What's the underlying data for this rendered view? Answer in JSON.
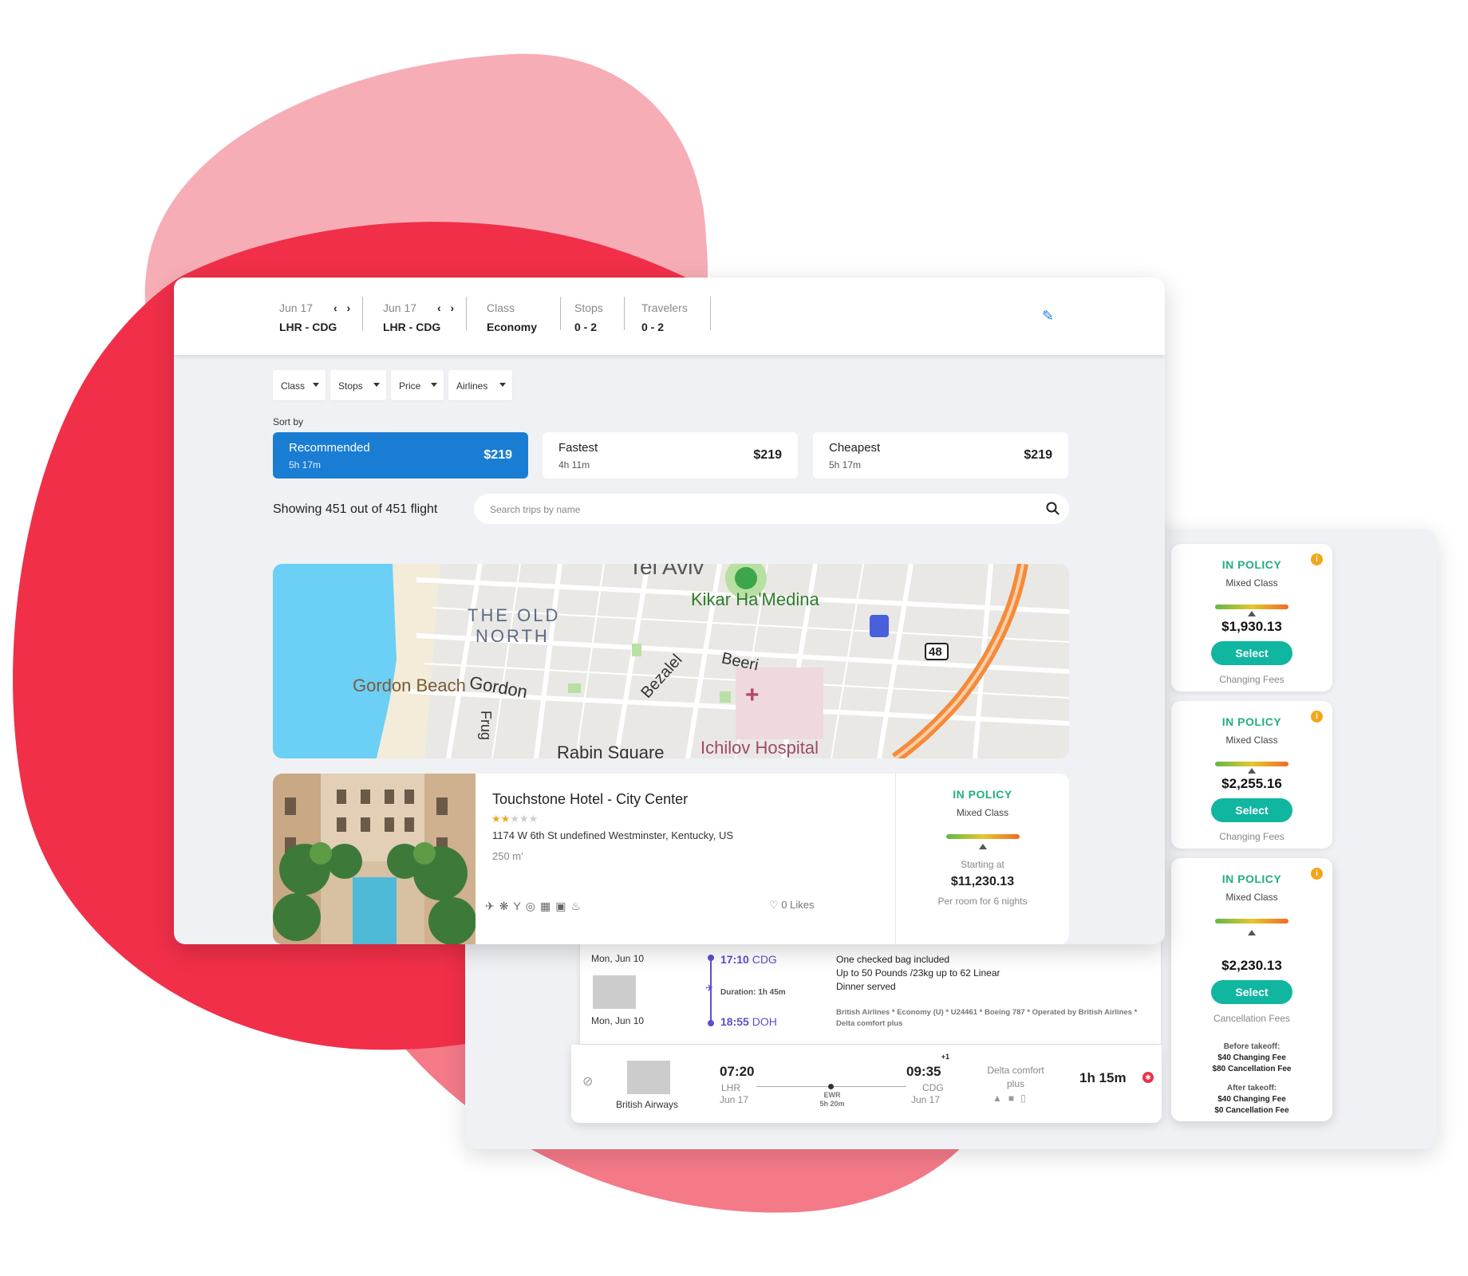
{
  "header": {
    "segments": [
      {
        "date": "Jun 17",
        "route": "LHR - CDG"
      },
      {
        "date": "Jun 17",
        "route": "LHR - CDG"
      }
    ],
    "class_label": "Class",
    "class_value": "Economy",
    "stops_label": "Stops",
    "stops_value": "0 - 2",
    "travelers_label": "Travelers",
    "travelers_value": "0 - 2",
    "edit_icon": "pencil-icon"
  },
  "filters": [
    "Class",
    "Stops",
    "Price",
    "Airlines"
  ],
  "sort": {
    "label": "Sort by",
    "options": [
      {
        "name": "Recommended",
        "duration": "5h 17m",
        "price": "$219"
      },
      {
        "name": "Fastest",
        "duration": "4h 11m",
        "price": "$219"
      },
      {
        "name": "Cheapest",
        "duration": "5h 17m",
        "price": "$219"
      }
    ]
  },
  "results": {
    "count_text": "Showing 451 out of 451 flight"
  },
  "search": {
    "placeholder": "Search trips by name"
  },
  "map": {
    "labels": [
      "Tel Aviv",
      "THE OLD",
      "NORTH",
      "Kikar Ha'Medina",
      "Beeri",
      "Bezalel",
      "Gordon Beach",
      "Gordon",
      "Frug",
      "Rabin Square",
      "Ichilov Hospital",
      "48"
    ]
  },
  "hotel": {
    "name": "Touchstone Hotel - City Center",
    "rating": 2,
    "rating_max": 5,
    "address": "1174 W 6th St undefined Westminster, Kentucky, US",
    "distance": "250 m'",
    "likes": "0 Likes",
    "policy": "IN POLICY",
    "policy_sub": "Mixed Class",
    "starting_label": "Starting at",
    "price": "$11,230.13",
    "price_note": "Per room for 6 nights"
  },
  "policy_cards": [
    {
      "status": "IN POLICY",
      "class": "Mixed Class",
      "price": "$1,930.13",
      "button": "Select",
      "fees": "Changing Fees"
    },
    {
      "status": "IN POLICY",
      "class": "Mixed Class",
      "price": "$2,255.16",
      "button": "Select",
      "fees": "Changing Fees"
    },
    {
      "status": "IN POLICY",
      "class": "Mixed Class",
      "price": "$2,230.13",
      "button": "Select",
      "fees": "Cancellation Fees",
      "before_label": "Before takeoff:",
      "before_change": "$40 Changing Fee",
      "before_cancel": "$80 Cancellation Fee",
      "after_label": "After takeoff:",
      "after_change": "$40 Changing Fee",
      "after_cancel": "$0 Cancellation Fee"
    }
  ],
  "flight_detail": {
    "date_top": "Mon, Jun 10",
    "date_bottom": "Mon, Jun 10",
    "dep_time": "17:10",
    "dep_code": "CDG",
    "duration": "Duration: 1h 45m",
    "arr_time": "18:55",
    "arr_code": "DOH",
    "notes": [
      "One checked bag included",
      "Up to 50 Pounds /23kg up to 62 Linear",
      "Dinner served"
    ],
    "operator": "British Airlines * Economy (U) * U24461  * Boeing 787 * Operated by British Airlines * Delta comfort plus"
  },
  "flight_row": {
    "airline": "British Airways",
    "dep_time": "07:20",
    "dep_code": "LHR",
    "dep_date": "Jun 17",
    "stop_code": "EWR",
    "stop_time": "5h 20m",
    "arr_time": "09:35",
    "arr_plus": "+1",
    "arr_code": "CDG",
    "arr_date": "Jun 17",
    "cabin": "Delta comfort plus",
    "duration": "1h 15m"
  },
  "colors": {
    "accent": "#1a7dd4",
    "policy": "#21b07c",
    "select": "#10b6a0",
    "blob_dark": "#f12f49",
    "blob_light": "#f7adb6",
    "blob_mid": "#f47a88"
  }
}
